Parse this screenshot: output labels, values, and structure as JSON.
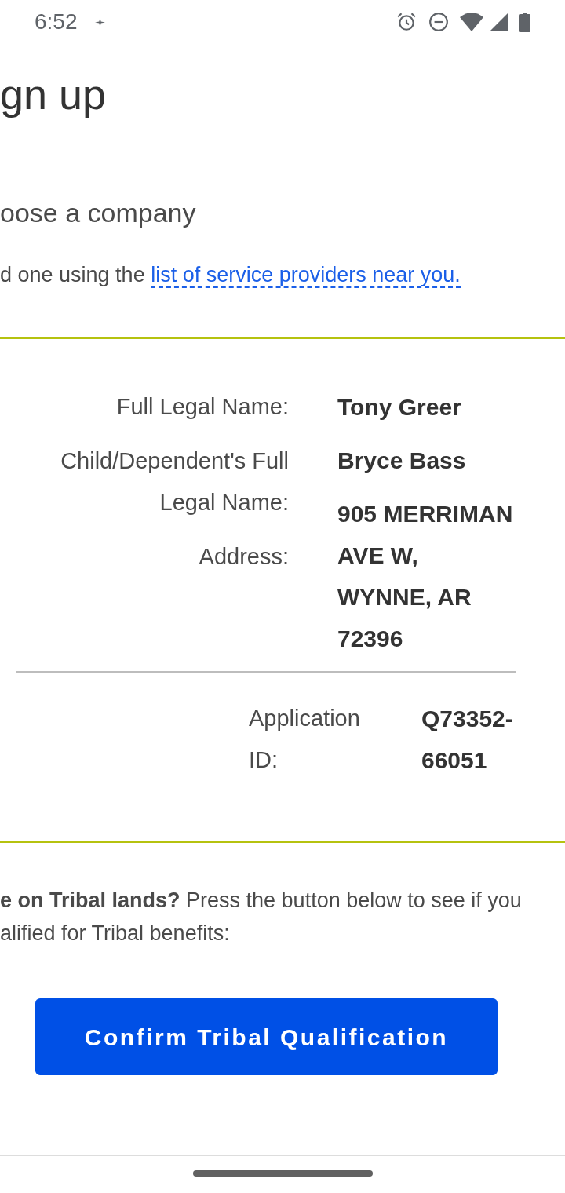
{
  "status_bar": {
    "time": "6:52"
  },
  "header": {
    "title": "gn up",
    "subheading": "oose a company",
    "hint": {
      "text": "d one using the",
      "link": "list of service providers near you."
    }
  },
  "details": {
    "rows": [
      {
        "label": "Full Legal Name:",
        "value": "Tony Greer"
      },
      {
        "label": "Child/Dependent's Full Legal Name:",
        "value": "Bryce Bass"
      },
      {
        "label": "Address:",
        "value": "905 MERRIMAN AVE W, WYNNE, AR 72396"
      }
    ],
    "application": {
      "label": "Application ID:",
      "value": "Q73352-66051"
    }
  },
  "tribal": {
    "lines": [
      "**e on Tribal lands?** Press the button below to see if you",
      "alified for Tribal benefits:"
    ],
    "button": "Confirm Tribal Qualification"
  }
}
